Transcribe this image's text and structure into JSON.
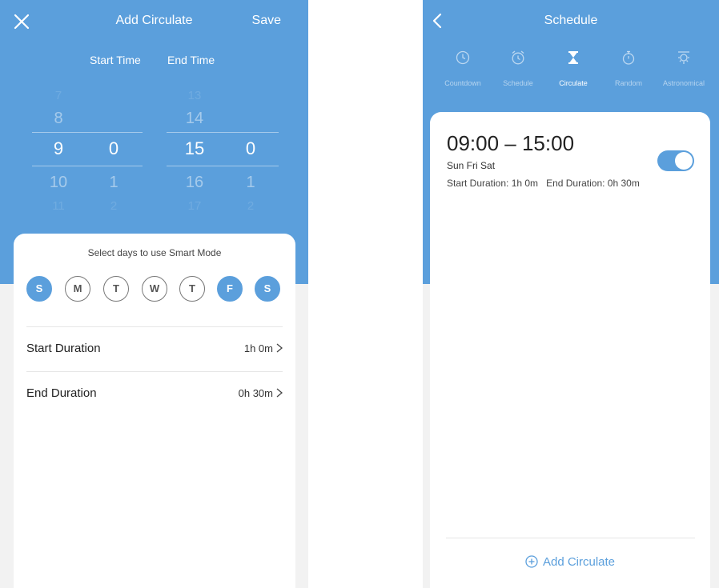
{
  "add_circulate": {
    "header": {
      "title": "Add Circulate",
      "save_label": "Save"
    },
    "columns": {
      "start_time": "Start Time",
      "end_time": "End Time"
    },
    "picker": {
      "start_hour": [
        "7",
        "8",
        "9",
        "10",
        "11"
      ],
      "start_minute": [
        "",
        "",
        "0",
        "1",
        "2"
      ],
      "end_hour": [
        "13",
        "14",
        "15",
        "16",
        "17"
      ],
      "end_minute": [
        "",
        "",
        "0",
        "1",
        "2"
      ]
    },
    "days_title": "Select days to use Smart Mode",
    "days": [
      {
        "label": "S",
        "selected": true
      },
      {
        "label": "M",
        "selected": false
      },
      {
        "label": "T",
        "selected": false
      },
      {
        "label": "W",
        "selected": false
      },
      {
        "label": "T",
        "selected": false
      },
      {
        "label": "F",
        "selected": true
      },
      {
        "label": "S",
        "selected": true
      }
    ],
    "start_duration": {
      "label": "Start Duration",
      "value": "1h 0m"
    },
    "end_duration": {
      "label": "End Duration",
      "value": "0h 30m"
    }
  },
  "schedule": {
    "header": {
      "title": "Schedule"
    },
    "tabs": [
      {
        "label": "Countdown",
        "icon": "clock-icon",
        "active": false
      },
      {
        "label": "Schedule",
        "icon": "alarm-clock-icon",
        "active": false
      },
      {
        "label": "Circulate",
        "icon": "hourglass-icon",
        "active": true
      },
      {
        "label": "Random",
        "icon": "stopwatch-icon",
        "active": false
      },
      {
        "label": "Astronomical",
        "icon": "sun-icon",
        "active": false
      }
    ],
    "item": {
      "time_range": "09:00 – 15:00",
      "days": "Sun Fri Sat",
      "start_duration": "Start Duration: 1h 0m",
      "end_duration": "End Duration: 0h 30m",
      "enabled": true
    },
    "add_label": "Add Circulate"
  },
  "colors": {
    "accent": "#5b9fdc",
    "card": "#ffffff",
    "background": "#f2f2f2"
  }
}
